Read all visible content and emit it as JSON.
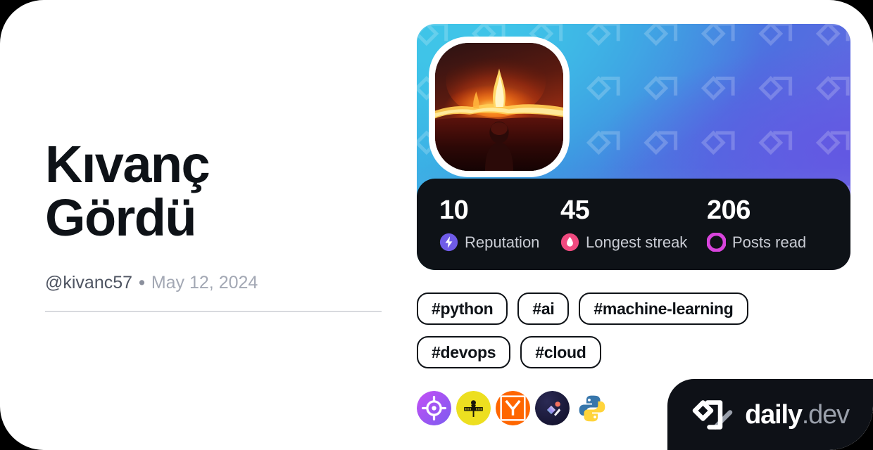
{
  "card": {
    "background_color": "#000000",
    "surface_color": "#ffffff"
  },
  "profile": {
    "display_name": "Kıvanç Gördü",
    "handle": "@kivanc57",
    "separator": "•",
    "join_date": "May 12, 2024",
    "avatar_alt": "volcano-eruption-photo"
  },
  "cover": {
    "watermark_icon": "daily-dev-logo-tile",
    "gradient_from": "#37b7e6",
    "gradient_to": "#6f63e2"
  },
  "stats": [
    {
      "value": "10",
      "label": "Reputation",
      "icon": "bolt-icon",
      "color": "#6f5be8"
    },
    {
      "value": "45",
      "label": "Longest streak",
      "icon": "flame-icon",
      "color": "#f04a7f"
    },
    {
      "value": "206",
      "label": "Posts read",
      "icon": "ring-icon",
      "color": "#d game"
    }
  ],
  "stat_colors": {
    "reputation": "#6f5be8",
    "longest_streak": "#f04a7f",
    "posts_read": "#d844dc"
  },
  "tags": [
    {
      "label": "#python"
    },
    {
      "label": "#ai"
    },
    {
      "label": "#machine-learning"
    },
    {
      "label": "#devops"
    },
    {
      "label": "#cloud"
    }
  ],
  "sources": [
    {
      "name": "target-crosshair-source-icon",
      "color": "#a855f7"
    },
    {
      "name": "hackernoon-source-icon",
      "color": "#eddf20"
    },
    {
      "name": "hacker-news-source-icon",
      "color": "#ff6600"
    },
    {
      "name": "dev-community-source-icon",
      "color": "#1c1b3a"
    },
    {
      "name": "python-source-icon",
      "color": "#3776ab"
    }
  ],
  "brand": {
    "logo_icon": "daily-dev-logo",
    "name": "daily",
    "tld": ".dev"
  }
}
